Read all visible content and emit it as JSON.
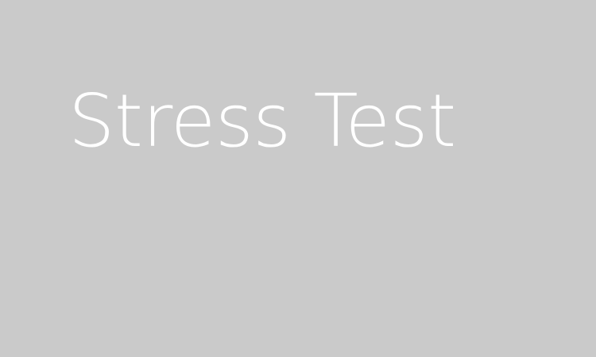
{
  "screen": {
    "title": "Stress Test",
    "background_color": "#cacaca",
    "text_color": "#ffffff"
  }
}
